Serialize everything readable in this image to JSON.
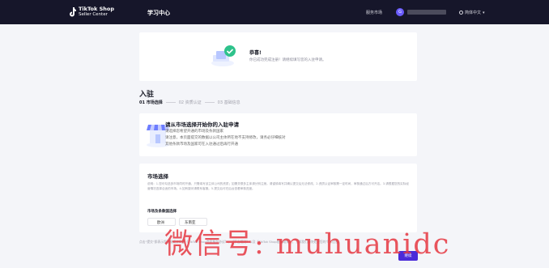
{
  "header": {
    "logo_main": "TikTok Shop",
    "logo_sub": "Seller Center",
    "nav_learning": "学习中心",
    "service_market": "服务市场",
    "language": "简体中文"
  },
  "congrats": {
    "title": "恭喜!",
    "desc": "你已成功完成注册！请继续填写您的入驻申请。"
  },
  "page_title": "入驻",
  "steps": [
    "01 市场选择",
    "02 资质认证",
    "03 基础信息"
  ],
  "choose": {
    "title": "请从市场选择开始你的入驻申请",
    "lines": [
      "请选择您希望开通的市场及条款国家",
      "请注意，本页面提交的数据以公司主体所在地不支持修改，请务必仔细核对",
      "其他条款市场及国家可在入驻通过后再行开通"
    ]
  },
  "market": {
    "title": "市场选择",
    "desc": "说明：1.您可勾选多市场同时开通，只需填写该主体公司的资质；如需关联多主体请分别注册。请谨慎填写并确认提交后无法修改。2.资质认证审核需一定时间，审核通过后方可开店。3.请根据您的实际经营情况选择合适的市场。4.如有疑问请联系客服。5.提交后可在后台查看审核进度。",
    "select_label": "市场及条款国选择",
    "options": [
      "欧洲",
      "东南亚"
    ]
  },
  "footer_note": "点击\"提交\"即表示您已阅读并同意《TikTok Shop商家服务协议》、《平台规则》以及《TikTok Shop隐私政策》，了解我们如何处理您的个人信息。",
  "next_label": "继续",
  "watermark": "微信号: muhuanidc",
  "colors": {
    "topbar": "#16162a",
    "primary": "#4b2bd8",
    "watermark": "#e63c46"
  }
}
